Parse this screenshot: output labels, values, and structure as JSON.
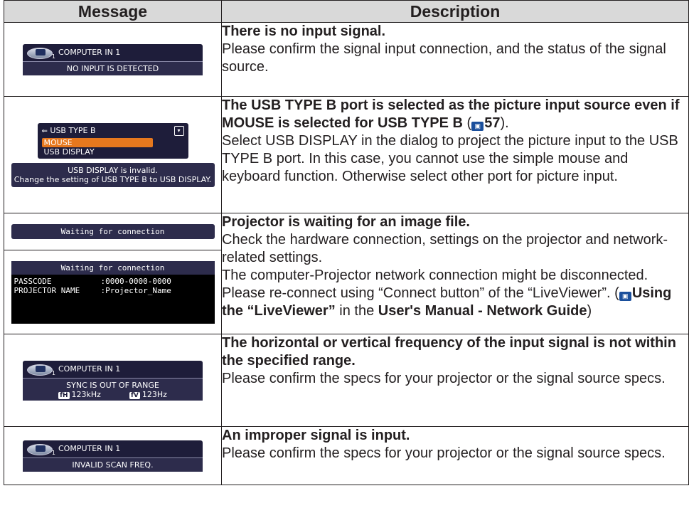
{
  "table": {
    "header_message": "Message",
    "header_description": "Description"
  },
  "row1": {
    "osd_title": "COMPUTER IN 1",
    "osd_sub": "1",
    "osd_message": "NO INPUT IS DETECTED",
    "bold": "There is no input signal.",
    "text": "Please confirm the signal input connection, and the status of the signal source."
  },
  "row2": {
    "osd_title": "USB TYPE B",
    "osd_option_selected": "MOUSE",
    "osd_option_2": "USB DISPLAY",
    "osd_line1": "USB DISPLAY is invalid.",
    "osd_line2": "Change the setting of USB TYPE B to USB DISPLAY.",
    "bold_a": "The USB TYPE B port is selected as the picture input source even if MOUSE is selected for USB TYPE B",
    "bold_paren_open": "(",
    "bold_ref": "57",
    "bold_paren_close": ").",
    "text": "Select USB DISPLAY in the dialog to project the picture input to the USB TYPE B port. In this case, you cannot use the simple mouse and keyboard function. Otherwise select other port for picture input."
  },
  "row3": {
    "osd_a": "Waiting for connection",
    "osd_b_title": "Waiting for connection",
    "osd_b_label1": "PASSCODE",
    "osd_b_value1": ":0000-0000-0000",
    "osd_b_label2": "PROJECTOR NAME",
    "osd_b_value2": ":Projector_Name",
    "bold": "Projector is waiting for an image file.",
    "text1": "Check the hardware connection, settings on the projector and network-related settings.",
    "text2": "The computer-Projector network connection might be disconnected. Please re-connect using “Connect button” of the “LiveViewer”. (",
    "ref_bold": "Using the “LiveViewer”",
    "text3": " in the ",
    "manual_bold": "User's Manual - Network Guide",
    "text4": ")"
  },
  "row4": {
    "osd_title": "COMPUTER IN 1",
    "osd_message": "SYNC IS OUT OF RANGE",
    "fh_label": "fH",
    "fh_value": "123kHz",
    "fv_label": "fV",
    "fv_value": "123Hz",
    "bold": "The horizontal or vertical frequency of the input signal is not within the specified range.",
    "text": "Please confirm the specs for your projector or the signal source specs."
  },
  "row5": {
    "osd_title": "COMPUTER IN 1",
    "osd_message": "INVALID SCAN FREQ.",
    "bold": "An improper signal is input.",
    "text": "Please confirm the specs for your projector or the signal source specs."
  }
}
